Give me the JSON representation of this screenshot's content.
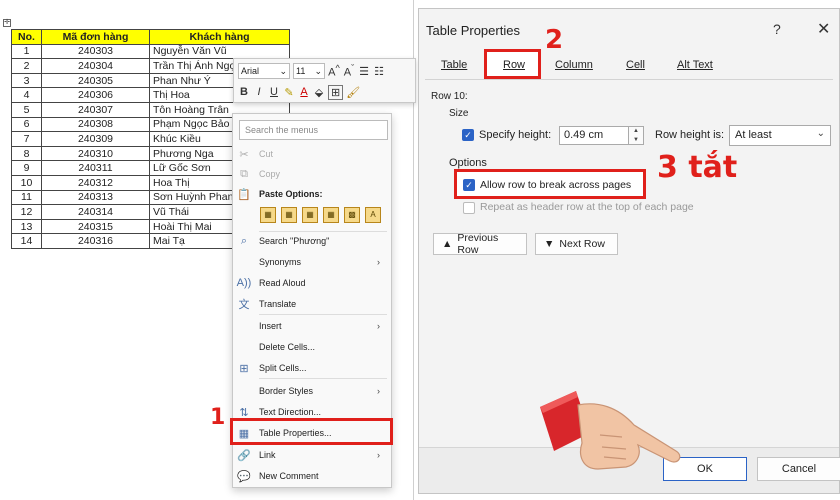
{
  "table": {
    "headers": [
      "No.",
      "Mã đơn hàng",
      "Khách hàng"
    ],
    "rows": [
      [
        "1",
        "240303",
        "Nguyễn Văn Vũ"
      ],
      [
        "2",
        "240304",
        "Trần Thị Ánh Ngọ"
      ],
      [
        "3",
        "240305",
        "Phan Như Ý"
      ],
      [
        "4",
        "240306",
        "Thị Hoa"
      ],
      [
        "5",
        "240307",
        "Tôn Hoàng Trân"
      ],
      [
        "6",
        "240308",
        "Phạm Ngọc Bảo"
      ],
      [
        "7",
        "240309",
        "Khúc Kiều"
      ],
      [
        "8",
        "240310",
        "Phương Nga"
      ],
      [
        "9",
        "240311",
        "Lữ Gốc Sơn"
      ],
      [
        "10",
        "240312",
        "Hoa Thị"
      ],
      [
        "11",
        "240313",
        "Sơn Huỳnh Phan"
      ],
      [
        "12",
        "240314",
        "Vũ Thái"
      ],
      [
        "13",
        "240315",
        "Hoài Thị Mai"
      ],
      [
        "14",
        "240316",
        "Mai Tạ"
      ]
    ]
  },
  "mini_toolbar": {
    "font": "Arial",
    "size": "11",
    "grow": "A",
    "shrink": "A",
    "bold": "B",
    "italic": "I",
    "underline": "U",
    "font_color": "A"
  },
  "context_menu": {
    "search_placeholder": "Search the menus",
    "cut": "Cut",
    "copy": "Copy",
    "paste_options": "Paste Options:",
    "paste_icon_letter": "A",
    "search_item": "Search \"Phương\"",
    "synonyms": "Synonyms",
    "read_aloud": "Read Aloud",
    "translate": "Translate",
    "insert": "Insert",
    "delete_cells": "Delete Cells...",
    "split_cells": "Split Cells...",
    "border_styles": "Border Styles",
    "text_direction": "Text Direction...",
    "table_properties": "Table Properties...",
    "link": "Link",
    "new_comment": "New Comment"
  },
  "dialog": {
    "title": "Table Properties",
    "help": "?",
    "close": "✕",
    "tabs": [
      "Table",
      "Row",
      "Column",
      "Cell",
      "Alt Text"
    ],
    "row_number": "Row 10:",
    "size_label": "Size",
    "specify_height_label": "Specify height:",
    "specify_height_checked": true,
    "height_value": "0.49 cm",
    "row_height_is_label": "Row height is:",
    "row_height_is_value": "At least",
    "options_label": "Options",
    "allow_break_label": "Allow row to break across pages",
    "allow_break_checked": true,
    "repeat_header_label": "Repeat as header row at the top of each page",
    "repeat_header_checked": false,
    "prev_row": "Previous Row",
    "next_row": "Next Row",
    "ok": "OK",
    "cancel": "Cancel"
  },
  "annotations": {
    "step1": "1",
    "step2": "2",
    "step3": "3 tắt"
  },
  "colors": {
    "header_fill": "#ffff00",
    "highlight": "#e0201b",
    "checkbox": "#2b63c6"
  }
}
